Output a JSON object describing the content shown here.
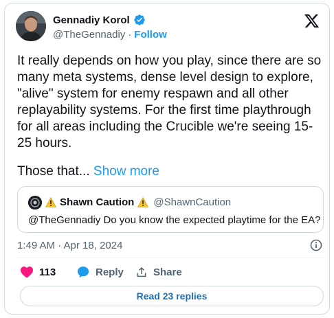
{
  "author": {
    "name": "Gennadiy Korol",
    "handle": "@TheGennadiy",
    "separator": "·",
    "follow_label": "Follow"
  },
  "tweet": {
    "text": "It really depends on how you play, since there are so\nmany meta systems, dense level design to explore,\n\"alive\" system for enemy respawn and all other\nreplayability systems. For the first time playthrough\nfor all areas including the Crucible we're seeing 15-\n25 hours.",
    "truncated_text": "Those that...",
    "show_more_label": "Show more"
  },
  "quote": {
    "name": "Shawn Caution",
    "handle": "@ShawnCaution",
    "text": "@TheGennadiy Do you know the expected playtime for the EA?"
  },
  "meta": {
    "timestamp": "1:49 AM · Apr 18, 2024"
  },
  "actions": {
    "likes_count": "113",
    "reply_label": "Reply",
    "share_label": "Share"
  },
  "read_replies_label": "Read 23 replies",
  "colors": {
    "accent": "#1d9bf0",
    "like": "#f91880",
    "text": "#0f1419",
    "muted": "#536471",
    "border": "#cfd9de"
  },
  "icons": [
    "verified-badge-icon",
    "x-logo-icon",
    "warning-icon",
    "info-icon",
    "heart-icon",
    "reply-bubble-icon",
    "share-icon"
  ]
}
